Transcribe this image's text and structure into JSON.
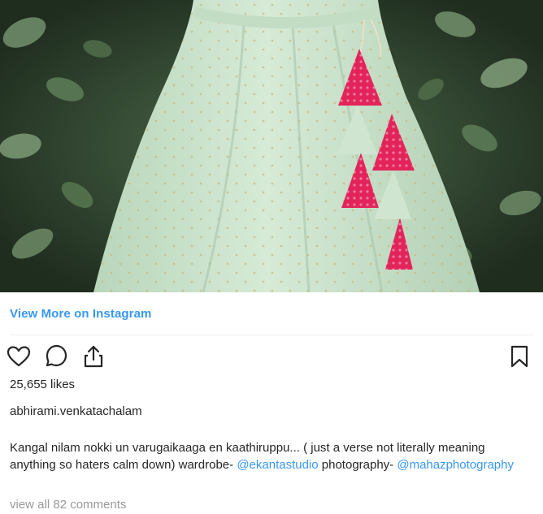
{
  "post": {
    "view_more_label": "View More on Instagram",
    "likes_text": "25,655 likes",
    "username": "abhirami.venkatachalam",
    "caption_text": "Kangal nilam nokki un varugaikaaga en kaathiruppu... ( just a verse not literally meaning anything so haters calm down) wardrobe- ",
    "mention_1": "@ekantastudio",
    "caption_mid": " photography- ",
    "mention_2": "@mahazphotography",
    "view_all_comments": "view all 82 comments"
  },
  "icons": {
    "like": "heart-outline-icon",
    "comment": "speech-bubble-icon",
    "share": "share-upload-icon",
    "save": "bookmark-icon"
  },
  "colors": {
    "link": "#3897f0",
    "text": "#262626",
    "muted": "#999999",
    "skirt": "#cfe5cf",
    "tassel": "#e0245e"
  }
}
